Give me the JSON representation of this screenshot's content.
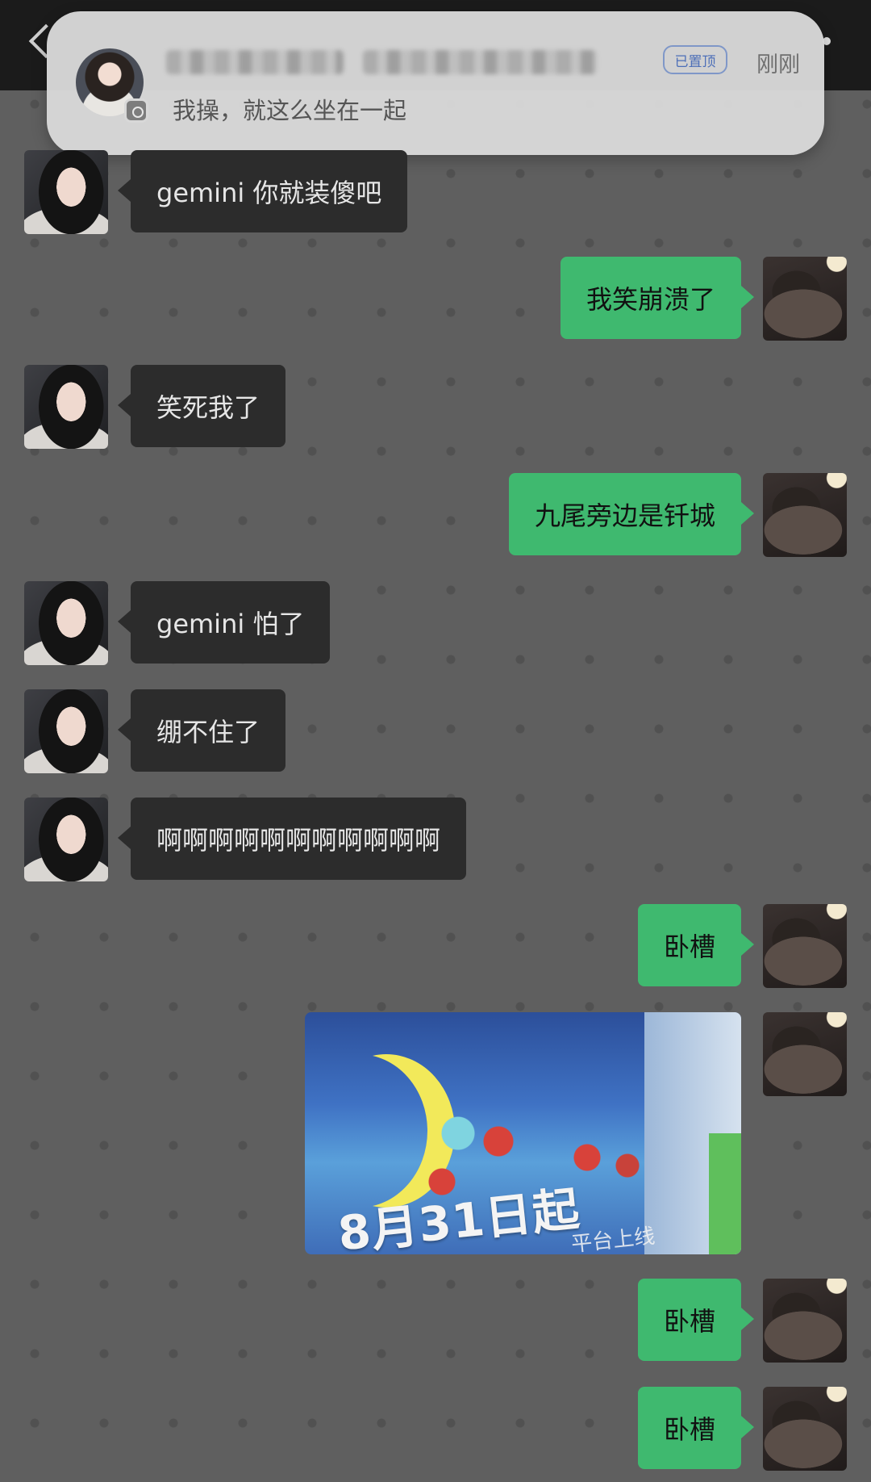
{
  "notification": {
    "message": "我操，就这么坐在一起",
    "pinned_label": "已置顶",
    "time": "刚刚"
  },
  "messages": [
    {
      "side": "left",
      "text": "gemini 你就装傻吧"
    },
    {
      "side": "right",
      "text": "我笑崩溃了"
    },
    {
      "side": "left",
      "text": "笑死我了"
    },
    {
      "side": "right",
      "text": "九尾旁边是钎城"
    },
    {
      "side": "left",
      "text": "gemini 怕了"
    },
    {
      "side": "left",
      "text": "绷不住了"
    },
    {
      "side": "left",
      "text": "啊啊啊啊啊啊啊啊啊啊啊"
    },
    {
      "side": "right",
      "text": "卧槽"
    },
    {
      "side": "right",
      "type": "image",
      "caption": "8月31日起",
      "subcaption": "平台上线"
    },
    {
      "side": "right",
      "text": "卧槽"
    },
    {
      "side": "right",
      "text": "卧槽"
    }
  ],
  "colors": {
    "chat_background": "#5f5f5f",
    "incoming_bubble": "#2c2c2c",
    "outgoing_bubble": "#3fb96f",
    "pin_badge": "#4d6fb8"
  },
  "icons": [
    "back-chevron-icon",
    "more-icon",
    "app-badge-icon"
  ]
}
